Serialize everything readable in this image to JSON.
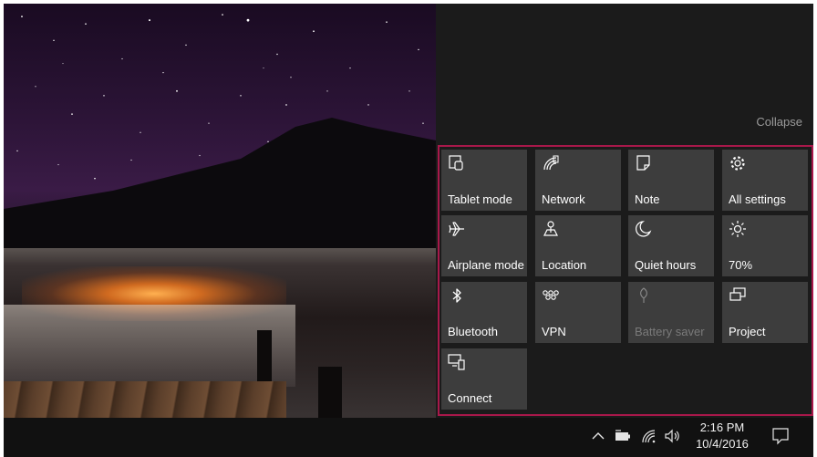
{
  "action_center": {
    "collapse_label": "Collapse",
    "accent_border": "#a8184a",
    "tiles": [
      {
        "label": "Tablet mode",
        "icon": "tablet-mode-icon",
        "enabled": true
      },
      {
        "label": "Network",
        "icon": "network-icon",
        "enabled": true
      },
      {
        "label": "Note",
        "icon": "note-icon",
        "enabled": true
      },
      {
        "label": "All settings",
        "icon": "gear-icon",
        "enabled": true
      },
      {
        "label": "Airplane mode",
        "icon": "airplane-icon",
        "enabled": true
      },
      {
        "label": "Location",
        "icon": "location-icon",
        "enabled": true
      },
      {
        "label": "Quiet hours",
        "icon": "moon-icon",
        "enabled": true
      },
      {
        "label": "70%",
        "icon": "brightness-icon",
        "enabled": true
      },
      {
        "label": "Bluetooth",
        "icon": "bluetooth-icon",
        "enabled": true
      },
      {
        "label": "VPN",
        "icon": "vpn-icon",
        "enabled": true
      },
      {
        "label": "Battery saver",
        "icon": "battery-saver-icon",
        "enabled": false
      },
      {
        "label": "Project",
        "icon": "project-icon",
        "enabled": true
      },
      {
        "label": "Connect",
        "icon": "connect-icon",
        "enabled": true
      }
    ]
  },
  "taskbar": {
    "time": "2:16 PM",
    "date": "10/4/2016",
    "tray_icons": [
      "chevron-up-icon",
      "battery-icon",
      "wifi-icon",
      "volume-icon"
    ],
    "notification_icon": "notification-icon"
  }
}
